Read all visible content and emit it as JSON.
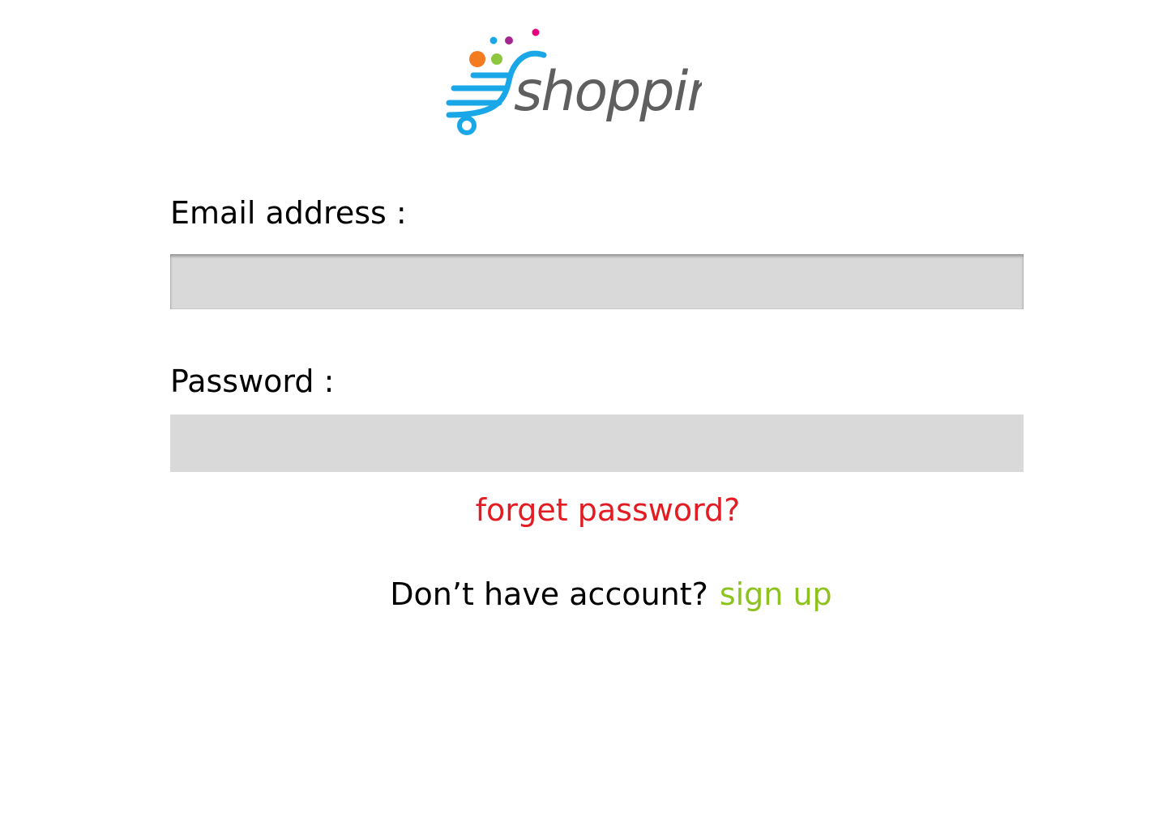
{
  "logo": {
    "text": "shopping",
    "colors": {
      "cart": "#1aa7e8",
      "word": "#5f5f5f",
      "dot_orange": "#f47b20",
      "dot_green": "#8dc63f",
      "dot_purple": "#a3278f",
      "dot_blue": "#1aa7e8",
      "dot_magenta": "#e6007e"
    }
  },
  "form": {
    "email_label": "Email address :",
    "email_value": "",
    "email_placeholder": "",
    "password_label": "Password :",
    "password_value": "",
    "password_placeholder": ""
  },
  "links": {
    "forget_password": "forget password?",
    "no_account_prompt": "Don’t have account?",
    "sign_up": "sign up"
  },
  "colors": {
    "field_bg": "#d9d9d9",
    "forget_link": "#e31b23",
    "signup_link": "#8dc21f",
    "text": "#000000"
  }
}
